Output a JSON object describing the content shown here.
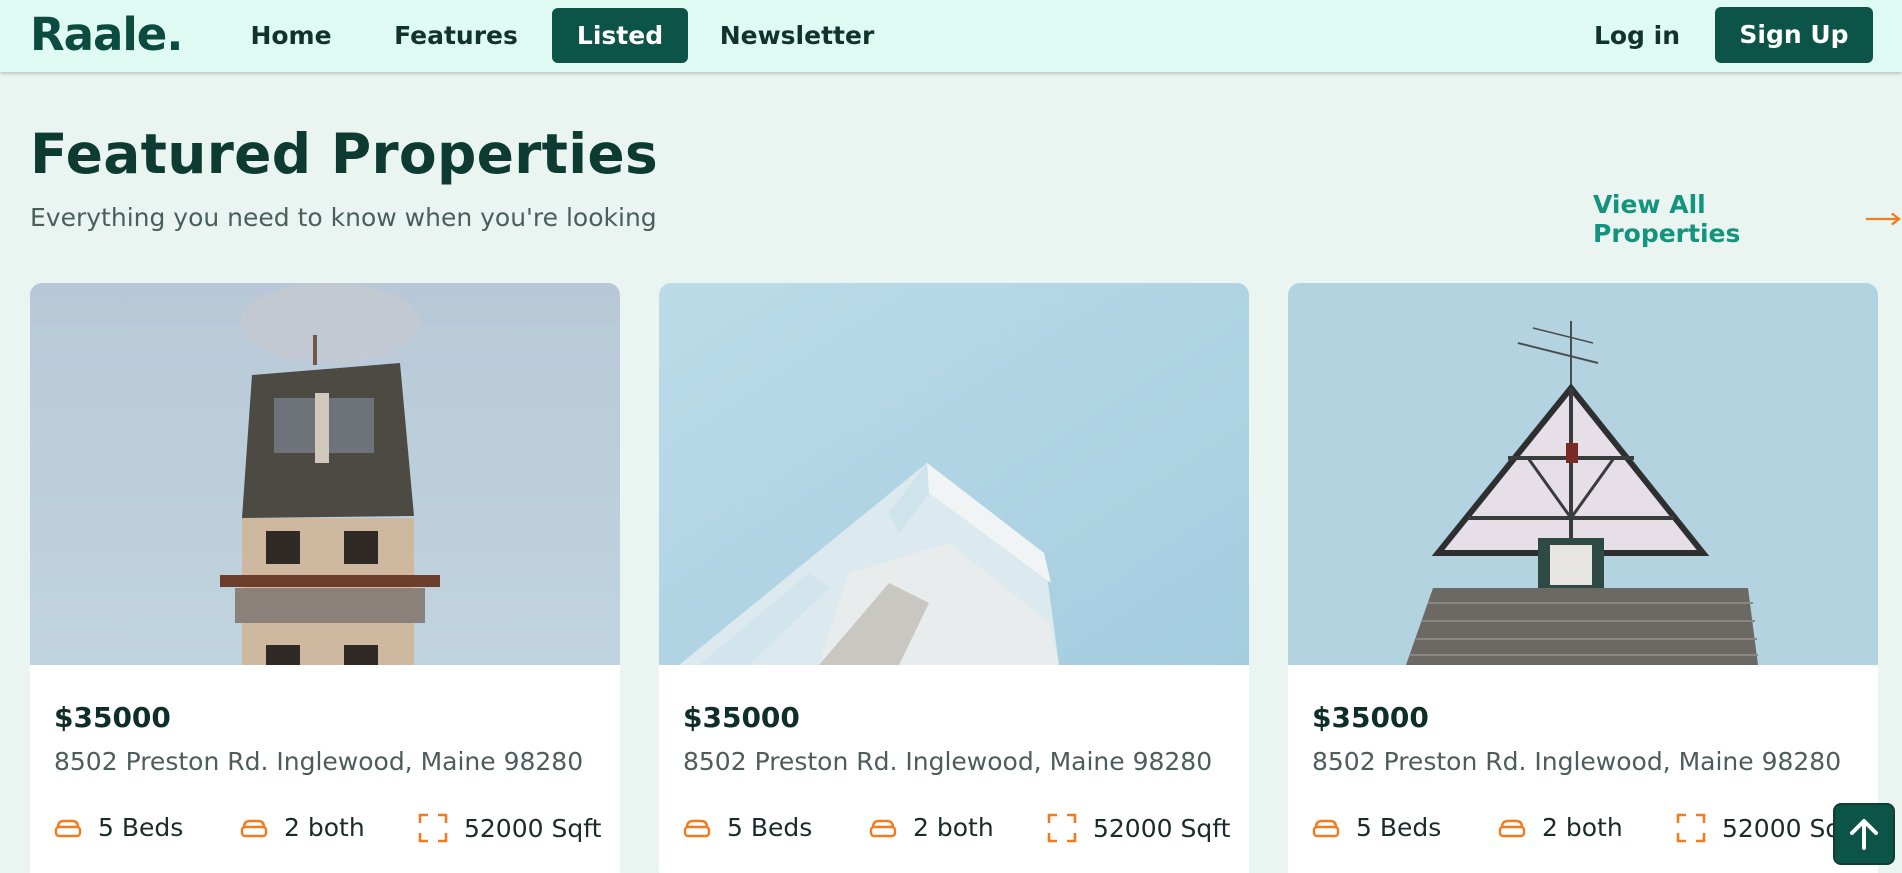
{
  "brand": {
    "logo": "Raale."
  },
  "nav": {
    "links": [
      {
        "label": "Home"
      },
      {
        "label": "Features"
      },
      {
        "label": "Listed"
      },
      {
        "label": "Newsletter"
      }
    ],
    "active": "Listed",
    "login_label": "Log in",
    "signup_label": "Sign Up"
  },
  "header": {
    "title": "Featured Properties",
    "subtitle": "Everything you need to know when you're looking",
    "view_all_label": "View All Properties",
    "view_all_icon": "arrow-right-icon"
  },
  "properties": [
    {
      "price": "$35000",
      "address": "8502 Preston Rd. Inglewood, Maine 98280",
      "beds": "5 Beds",
      "baths": "2 both",
      "area": "52000 Sqft",
      "image": "narrow-old-house-photo"
    },
    {
      "price": "$35000",
      "address": "8502 Preston Rd. Inglewood, Maine 98280",
      "beds": "5 Beds",
      "baths": "2 both",
      "area": "52000 Sqft",
      "image": "modern-building-corner-photo"
    },
    {
      "price": "$35000",
      "address": "8502 Preston Rd. Inglewood, Maine 98280",
      "beds": "5 Beds",
      "baths": "2 both",
      "area": "52000 Sqft",
      "image": "tudor-house-roof-photo"
    }
  ],
  "icons": {
    "beds": "bed-icon",
    "baths": "bath-icon",
    "area": "area-icon",
    "scroll_top": "arrow-up-icon"
  },
  "colors": {
    "primary": "#0c5447",
    "accent_link": "#12957c",
    "accent_icon": "#f07c1f",
    "nav_bg": "#defaf3",
    "page_bg": "#eaf5f1"
  }
}
